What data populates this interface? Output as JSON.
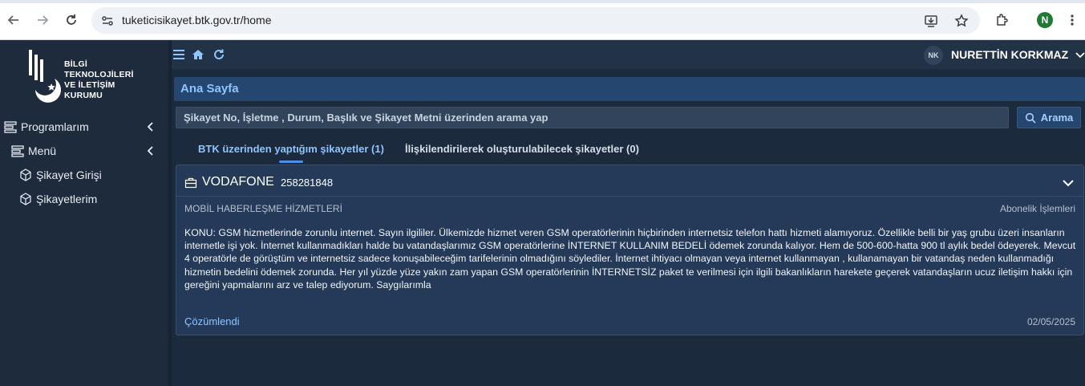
{
  "browser": {
    "url": "tuketicisikayet.btk.gov.tr/home",
    "profile_initial": "N",
    "icons": [
      "back-arrow-icon",
      "forward-arrow-icon",
      "reload-icon",
      "site-settings-icon",
      "install-app-icon",
      "bookmark-star-icon",
      "extensions-icon",
      "more-vert-icon"
    ]
  },
  "sidebar": {
    "logo_text": [
      "BİLGİ",
      "TEKNOLOJİLERİ",
      "VE İLETİŞİM",
      "KURUMU"
    ],
    "items": [
      {
        "label": "Programlarım",
        "icon": "stack-icon",
        "has_chevron": true
      },
      {
        "label": "Menü",
        "icon": "stack-icon",
        "has_chevron": true
      },
      {
        "label": "Şikayet Girişi",
        "icon": "cube-icon",
        "has_chevron": false
      },
      {
        "label": "Şikayetlerim",
        "icon": "cube-icon",
        "has_chevron": false
      }
    ]
  },
  "topbar": {
    "user_initials": "NK",
    "user_name": "NURETTİN KORKMAZ",
    "icons": [
      "hamburger-menu-icon",
      "home-icon",
      "refresh-icon"
    ]
  },
  "page": {
    "title": "Ana Sayfa",
    "search_placeholder": "Şikayet No, İşletme , Durum, Başlık ve Şikayet Metni üzerinden arama yap",
    "search_button": "Arama",
    "tabs": [
      {
        "label": "BTK üzerinden yaptığım şikayetler (1)",
        "active": true
      },
      {
        "label": "İlişkilendirilerek oluşturulabilecek şikayetler (0)",
        "active": false
      }
    ]
  },
  "complaint": {
    "company": "VODAFONE",
    "ticket_no": "258281848",
    "category": "MOBİL HABERLEŞME HİZMETLERİ",
    "subcategory": "Abonelik İşlemleri",
    "text": "KONU: GSM hizmetlerinde zorunlu internet. Sayın ilgililer. Ülkemizde hizmet veren GSM operatörlerinin hiçbirinden internetsiz telefon hattı hizmeti alamıyoruz. Özellikle belli bir yaş grubu üzeri insanların internetle işi yok. İnternet kullanmadıkları halde bu vatandaşlarımız GSM operatörlerine İNTERNET KULLANIM BEDELİ ödemek zorunda kalıyor. Hem de 500-600-hatta 900 tl aylık bedel ödeyerek. Mevcut 4 operatörle de görüştüm ve internetsiz sadece konuşabileceğim tarifelerinin olmadığını söylediler. İnternet ihtiyacı olmayan veya internet kullanmayan , kullanamayan bir vatandaş neden kullanmadığı hizmetin bedelini ödemek zorunda. Her yıl yüzde yüze yakın zam yapan GSM operatörlerinin İNTERNETSİZ paket te verilmesi için ilgili bakanlıkların harekete geçerek vatandaşların ucuz iletişim hakkı için gereğini yapmalarını arz ve talep ediyorum. Saygılarımla",
    "status": "Çözümlendi",
    "date": "02/05/2025"
  }
}
